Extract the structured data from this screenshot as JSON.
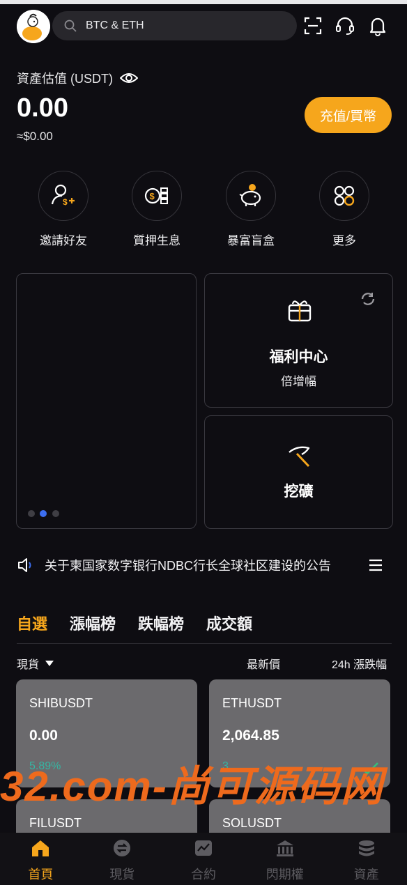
{
  "header": {
    "search_text": "BTC & ETH",
    "icons": [
      "scan-icon",
      "headset-icon",
      "bell-icon"
    ]
  },
  "asset": {
    "label": "資產估值 (USDT)",
    "value": "0.00",
    "sub_value": "≈$0.00",
    "deposit_label": "充值/買幣"
  },
  "quick_actions": [
    {
      "label": "邀請好友",
      "icon": "invite-friend-icon"
    },
    {
      "label": "質押生息",
      "icon": "staking-coin-icon"
    },
    {
      "label": "暴富盲盒",
      "icon": "piggy-bank-icon"
    },
    {
      "label": "更多",
      "icon": "more-grid-icon"
    }
  ],
  "promo": {
    "welfare_title": "福利中心",
    "welfare_sub": "倍增幅",
    "mining_title": "挖礦"
  },
  "notice": {
    "text": "关于柬国家数字银行NDBC行长全球社区建设的公告"
  },
  "market": {
    "tabs": [
      "自選",
      "漲幅榜",
      "跌幅榜",
      "成交額"
    ],
    "active_tab": 0,
    "filter_label": "現貨",
    "col_price": "最新價",
    "col_change": "24h 漲跌幅",
    "cards": [
      {
        "symbol": "SHIBUSDT",
        "price": "0.00",
        "change": "5.89%"
      },
      {
        "symbol": "ETHUSDT",
        "price": "2,064.85",
        "change": "3."
      },
      {
        "symbol": "FILUSDT",
        "price": "",
        "change": ""
      },
      {
        "symbol": "SOLUSDT",
        "price": "",
        "change": ""
      }
    ]
  },
  "watermark": "32.com-尚可源码网",
  "nav": [
    {
      "label": "首頁",
      "icon": "home-icon"
    },
    {
      "label": "現貨",
      "icon": "spot-exchange-icon"
    },
    {
      "label": "合約",
      "icon": "contract-chart-icon"
    },
    {
      "label": "閃期權",
      "icon": "bank-icon"
    },
    {
      "label": "資產",
      "icon": "wallet-stack-icon"
    }
  ],
  "colors": {
    "accent": "#f6a61c",
    "background": "#0e0d12",
    "card": "#6b6a6d",
    "up": "#35b5a3"
  }
}
